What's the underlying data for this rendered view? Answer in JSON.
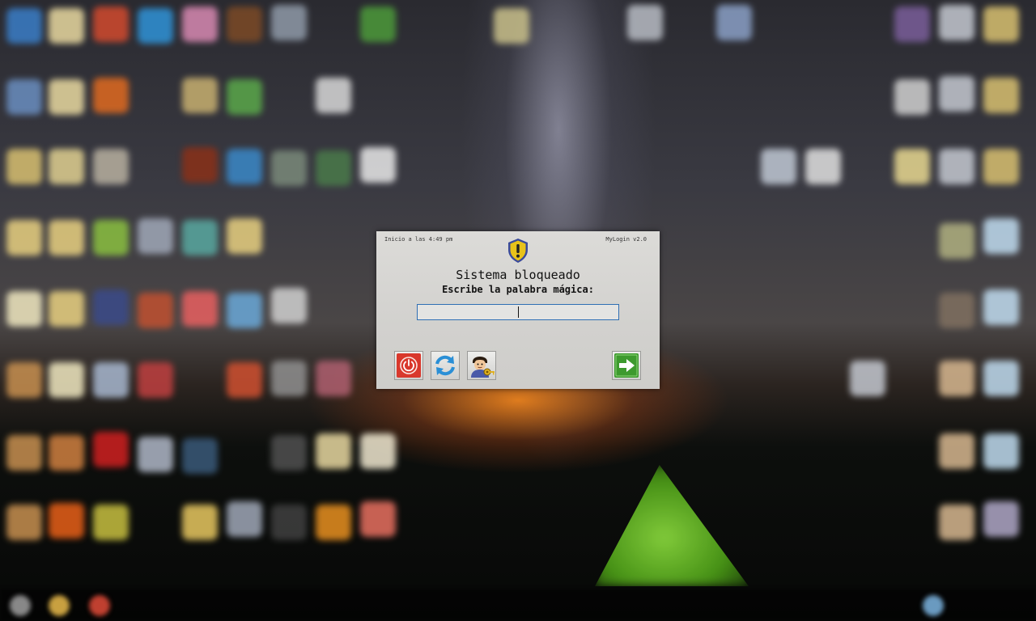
{
  "screen": {
    "kind": "locked-desktop"
  },
  "dialog": {
    "start_info": "Inicio a las 4:49 pm",
    "app_version": "MyLogin v2.0",
    "title": "Sistema bloqueado",
    "prompt": "Escribe la palabra mágica:",
    "password_value": "",
    "icons": {
      "header": "shield-warning-icon",
      "power": "power-icon",
      "refresh": "refresh-icon",
      "user_key": "user-key-icon",
      "enter": "arrow-right-icon"
    },
    "colors": {
      "power_button": "#d9382c",
      "refresh_button": "#2a8fd6",
      "enter_button": "#3d9a2e",
      "input_border": "#2f6fb4",
      "shield": "#e8c21a"
    }
  }
}
